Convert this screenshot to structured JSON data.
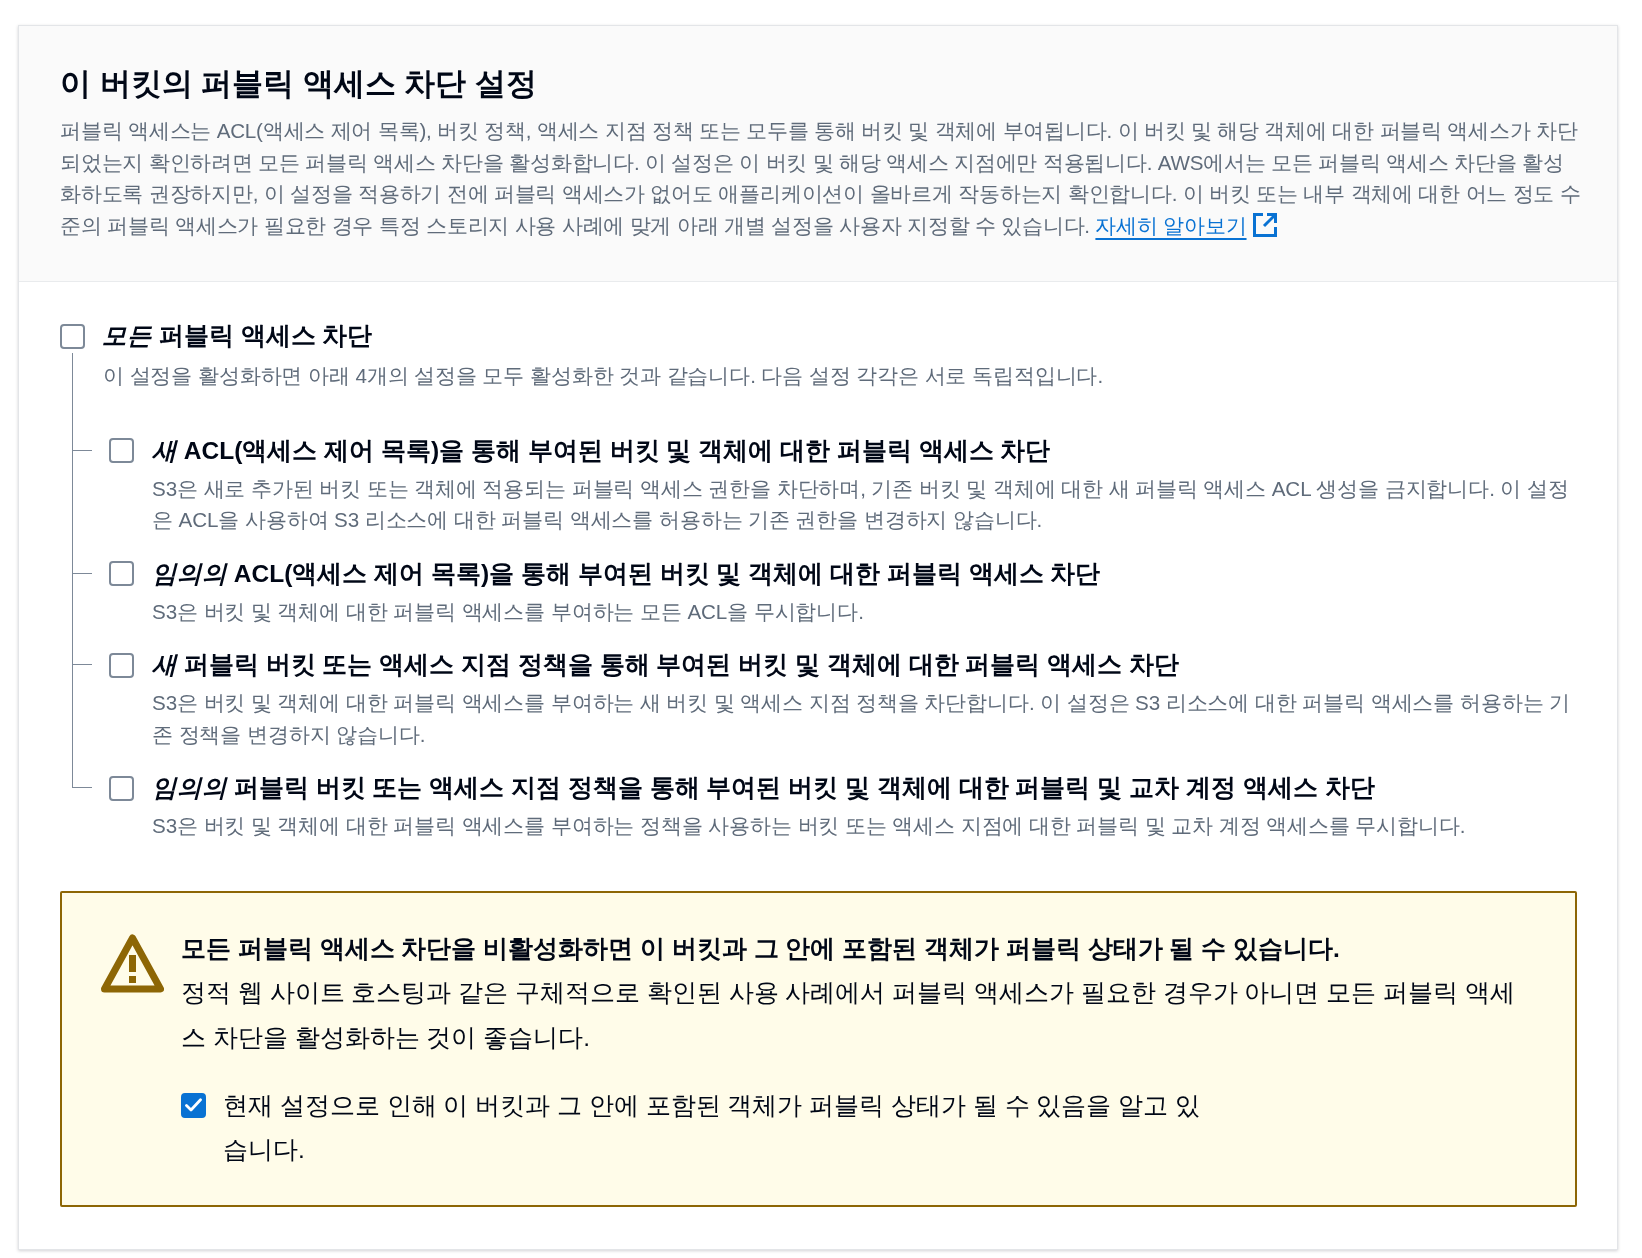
{
  "panel": {
    "title": "이 버킷의 퍼블릭 액세스 차단 설정",
    "description": "퍼블릭 액세스는 ACL(액세스 제어 목록), 버킷 정책, 액세스 지점 정책 또는 모두를 통해 버킷 및 객체에 부여됩니다. 이 버킷 및 해당 객체에 대한 퍼블릭 액세스가 차단되었는지 확인하려면 모든 퍼블릭 액세스 차단을 활성화합니다. 이 설정은 이 버킷 및 해당 액세스 지점에만 적용됩니다. AWS에서는 모든 퍼블릭 액세스 차단을 활성화하도록 권장하지만, 이 설정을 적용하기 전에 퍼블릭 액세스가 없어도 애플리케이션이 올바르게 작동하는지 확인합니다. 이 버킷 또는 내부 객체에 대한 어느 정도 수준의 퍼블릭 액세스가 필요한 경우 특정 스토리지 사용 사례에 맞게 아래 개별 설정을 사용자 지정할 수 있습니다.",
    "learn_more_link": "자세히 알아보기"
  },
  "block_all": {
    "label": "*모든* 퍼블릭 액세스 차단",
    "checked": false,
    "description": "이 설정을 활성화하면 아래 4개의 설정을 모두 활성화한 것과 같습니다. 다음 설정 각각은 서로 독립적입니다."
  },
  "settings": [
    {
      "label": "*새* ACL(액세스 제어 목록)을 통해 부여된 버킷 및 객체에 대한 퍼블릭 액세스 차단",
      "checked": false,
      "description": "S3은 새로 추가된 버킷 또는 객체에 적용되는 퍼블릭 액세스 권한을 차단하며, 기존 버킷 및 객체에 대한 새 퍼블릭 액세스 ACL 생성을 금지합니다. 이 설정은 ACL을 사용하여 S3 리소스에 대한 퍼블릭 액세스를 허용하는 기존 권한을 변경하지 않습니다."
    },
    {
      "label": "*임의의* ACL(액세스 제어 목록)을 통해 부여된 버킷 및 객체에 대한 퍼블릭 액세스 차단",
      "checked": false,
      "description": "S3은 버킷 및 객체에 대한 퍼블릭 액세스를 부여하는 모든 ACL을 무시합니다."
    },
    {
      "label": "*새* 퍼블릭 버킷 또는 액세스 지점 정책을 통해 부여된 버킷 및 객체에 대한 퍼블릭 액세스 차단",
      "checked": false,
      "description": "S3은 버킷 및 객체에 대한 퍼블릭 액세스를 부여하는 새 버킷 및 액세스 지점 정책을 차단합니다. 이 설정은 S3 리소스에 대한 퍼블릭 액세스를 허용하는 기존 정책을 변경하지 않습니다."
    },
    {
      "label": "*임의의* 퍼블릭 버킷 또는 액세스 지점 정책을 통해 부여된 버킷 및 객체에 대한 퍼블릭 및 교차 계정 액세스 차단",
      "checked": false,
      "description": "S3은 버킷 및 객체에 대한 퍼블릭 액세스를 부여하는 정책을 사용하는 버킷 또는 액세스 지점에 대한 퍼블릭 및 교차 계정 액세스를 무시합니다."
    }
  ],
  "warning": {
    "title": "모든 퍼블릭 액세스 차단을 비활성화하면 이 버킷과 그 안에 포함된 객체가 퍼블릭 상태가 될 수 있습니다.",
    "body": "정적 웹 사이트 호스팅과 같은 구체적으로 확인된 사용 사례에서 퍼블릭 액세스가 필요한 경우가 아니면 모든 퍼블릭 액세스 차단을 활성화하는 것이 좋습니다.",
    "acknowledge": {
      "label": "현재 설정으로 인해 이 버킷과 그 안에 포함된 객체가 퍼블릭 상태가 될 수 있음을 알고 있습니다.",
      "checked": true
    }
  }
}
